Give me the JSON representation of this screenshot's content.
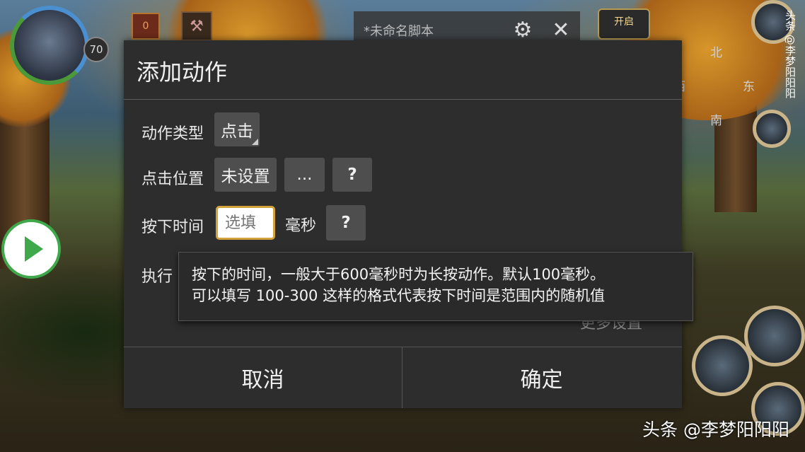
{
  "game": {
    "level": "70",
    "gem_count": "0",
    "compass": {
      "north": "北",
      "east": "东",
      "south": "南",
      "west": "西"
    },
    "watermark_side": "头条 @李梦阳阳阳",
    "watermark_corner": "头条 @李梦阳阳阳"
  },
  "script_bar": {
    "name": "*未命名脚本",
    "start_label": "开启",
    "icons": [
      "gear-icon",
      "close-icon"
    ]
  },
  "dialog": {
    "title": "添加动作",
    "action_type": {
      "label": "动作类型",
      "value": "点击"
    },
    "click_position": {
      "label": "点击位置",
      "value": "未设置",
      "more_label": "...",
      "help_label": "?"
    },
    "press_time": {
      "label": "按下时间",
      "placeholder": "选填",
      "unit": "毫秒",
      "help_label": "?"
    },
    "execute": {
      "label": "执行"
    },
    "more_settings": "更多设置",
    "cancel_label": "取消",
    "confirm_label": "确定"
  },
  "tooltip": {
    "line1": "按下的时间，一般大于600毫秒时为长按动作。默认100毫秒。",
    "line2": "可以填写 100-300 这样的格式代表按下时间是范围内的随机值"
  }
}
